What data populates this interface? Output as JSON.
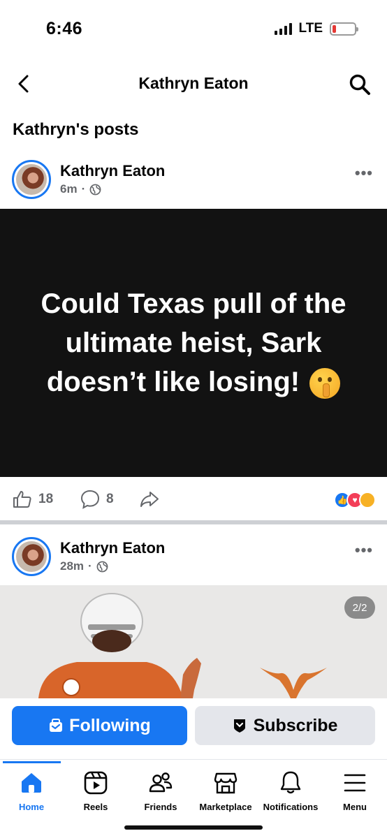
{
  "status": {
    "time": "6:46",
    "network": "LTE"
  },
  "header": {
    "title": "Kathryn Eaton"
  },
  "section": {
    "title": "Kathryn's posts"
  },
  "posts": [
    {
      "author": "Kathryn Eaton",
      "time": "6m",
      "text": "Could Texas pull of the ultimate heist, Sark doesn’t like losing!",
      "likes": "18",
      "comments": "8"
    },
    {
      "author": "Kathryn Eaton",
      "time": "28m",
      "photo_counter": "2/2"
    }
  ],
  "follow_bar": {
    "following_label": "Following",
    "subscribe_label": "Subscribe"
  },
  "tabs": [
    {
      "label": "Home",
      "icon": "home-icon",
      "active": true
    },
    {
      "label": "Reels",
      "icon": "reels-icon"
    },
    {
      "label": "Friends",
      "icon": "friends-icon"
    },
    {
      "label": "Marketplace",
      "icon": "marketplace-icon"
    },
    {
      "label": "Notifications",
      "icon": "bell-icon"
    },
    {
      "label": "Menu",
      "icon": "menu-icon"
    }
  ],
  "colors": {
    "accent": "#1877f2",
    "secondary_button": "#e4e6eb",
    "post_background": "#121212"
  }
}
